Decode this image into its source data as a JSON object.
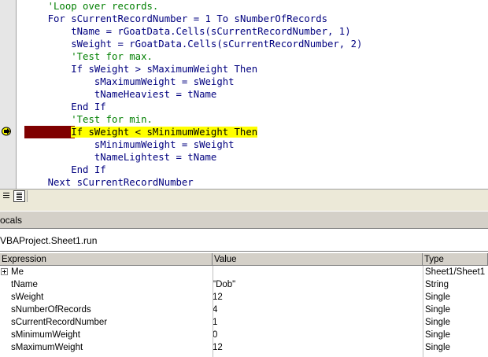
{
  "code_lines": [
    {
      "indent": "    ",
      "parts": [
        {
          "cls": "cm",
          "t": "'Loop over records."
        }
      ]
    },
    {
      "indent": "    ",
      "parts": [
        {
          "cls": "kw",
          "t": "For "
        },
        {
          "cls": "kw",
          "t": "sCurrentRecordNumber = 1 "
        },
        {
          "cls": "kw",
          "t": "To"
        },
        {
          "cls": "kw",
          "t": " sNumberOfRecords"
        }
      ]
    },
    {
      "indent": "        ",
      "parts": [
        {
          "cls": "kw",
          "t": "tName = rGoatData.Cells(sCurrentRecordNumber, 1)"
        }
      ]
    },
    {
      "indent": "        ",
      "parts": [
        {
          "cls": "kw",
          "t": "sWeight = rGoatData.Cells(sCurrentRecordNumber, 2)"
        }
      ]
    },
    {
      "indent": "        ",
      "parts": [
        {
          "cls": "cm",
          "t": "'Test for max."
        }
      ]
    },
    {
      "indent": "        ",
      "parts": [
        {
          "cls": "kw",
          "t": "If sWeight > sMaximumWeight Then"
        }
      ]
    },
    {
      "indent": "            ",
      "parts": [
        {
          "cls": "kw",
          "t": "sMaximumWeight = sWeight"
        }
      ]
    },
    {
      "indent": "            ",
      "parts": [
        {
          "cls": "kw",
          "t": "tNameHeaviest = tName"
        }
      ]
    },
    {
      "indent": "        ",
      "parts": [
        {
          "cls": "kw",
          "t": "End If"
        }
      ]
    },
    {
      "indent": "        ",
      "parts": [
        {
          "cls": "cm",
          "t": "'Test for min."
        }
      ]
    },
    {
      "indent": "        ",
      "highlight": true,
      "parts": [
        {
          "cls": "kw",
          "t": "If sWeight < sMinimumWeight Then"
        }
      ]
    },
    {
      "indent": "            ",
      "parts": [
        {
          "cls": "kw",
          "t": "sMinimumWeight = sWeight"
        }
      ]
    },
    {
      "indent": "            ",
      "parts": [
        {
          "cls": "kw",
          "t": "tNameLightest = tName"
        }
      ]
    },
    {
      "indent": "        ",
      "parts": [
        {
          "cls": "kw",
          "t": "End If"
        }
      ]
    },
    {
      "indent": "    ",
      "parts": [
        {
          "cls": "kw",
          "t": "Next sCurrentRecordNumber"
        }
      ]
    }
  ],
  "locals": {
    "title": "Locals",
    "title_visible": "ocals",
    "context": "VBAProject.Sheet1.run",
    "context_visible": "VBAProject.Sheet1.run",
    "columns": {
      "expression": "Expression",
      "value": "Value",
      "type": "Type"
    },
    "rows": [
      {
        "expression": "Me",
        "value": "",
        "type": "Sheet1/Sheet1",
        "expandable": true
      },
      {
        "expression": "tName",
        "value": "\"Dob\"",
        "type": "String"
      },
      {
        "expression": "sWeight",
        "value": "12",
        "type": "Single"
      },
      {
        "expression": "sNumberOfRecords",
        "value": "4",
        "type": "Single"
      },
      {
        "expression": "sCurrentRecordNumber",
        "value": "1",
        "type": "Single"
      },
      {
        "expression": "sMinimumWeight",
        "value": "0",
        "type": "Single"
      },
      {
        "expression": "sMaximumWeight",
        "value": "12",
        "type": "Single"
      }
    ]
  },
  "icons": {
    "execution_arrow": "current-statement-arrow-icon",
    "procedure_view": "procedure-view-icon",
    "full_module_view": "full-module-view-icon",
    "expand": "expand-plus-icon"
  },
  "colors": {
    "comment": "#007f00",
    "keyword": "#00007f",
    "current_line": "#ffff00",
    "breakpoint_bar": "#7f0000",
    "chrome": "#d4d0c8"
  }
}
